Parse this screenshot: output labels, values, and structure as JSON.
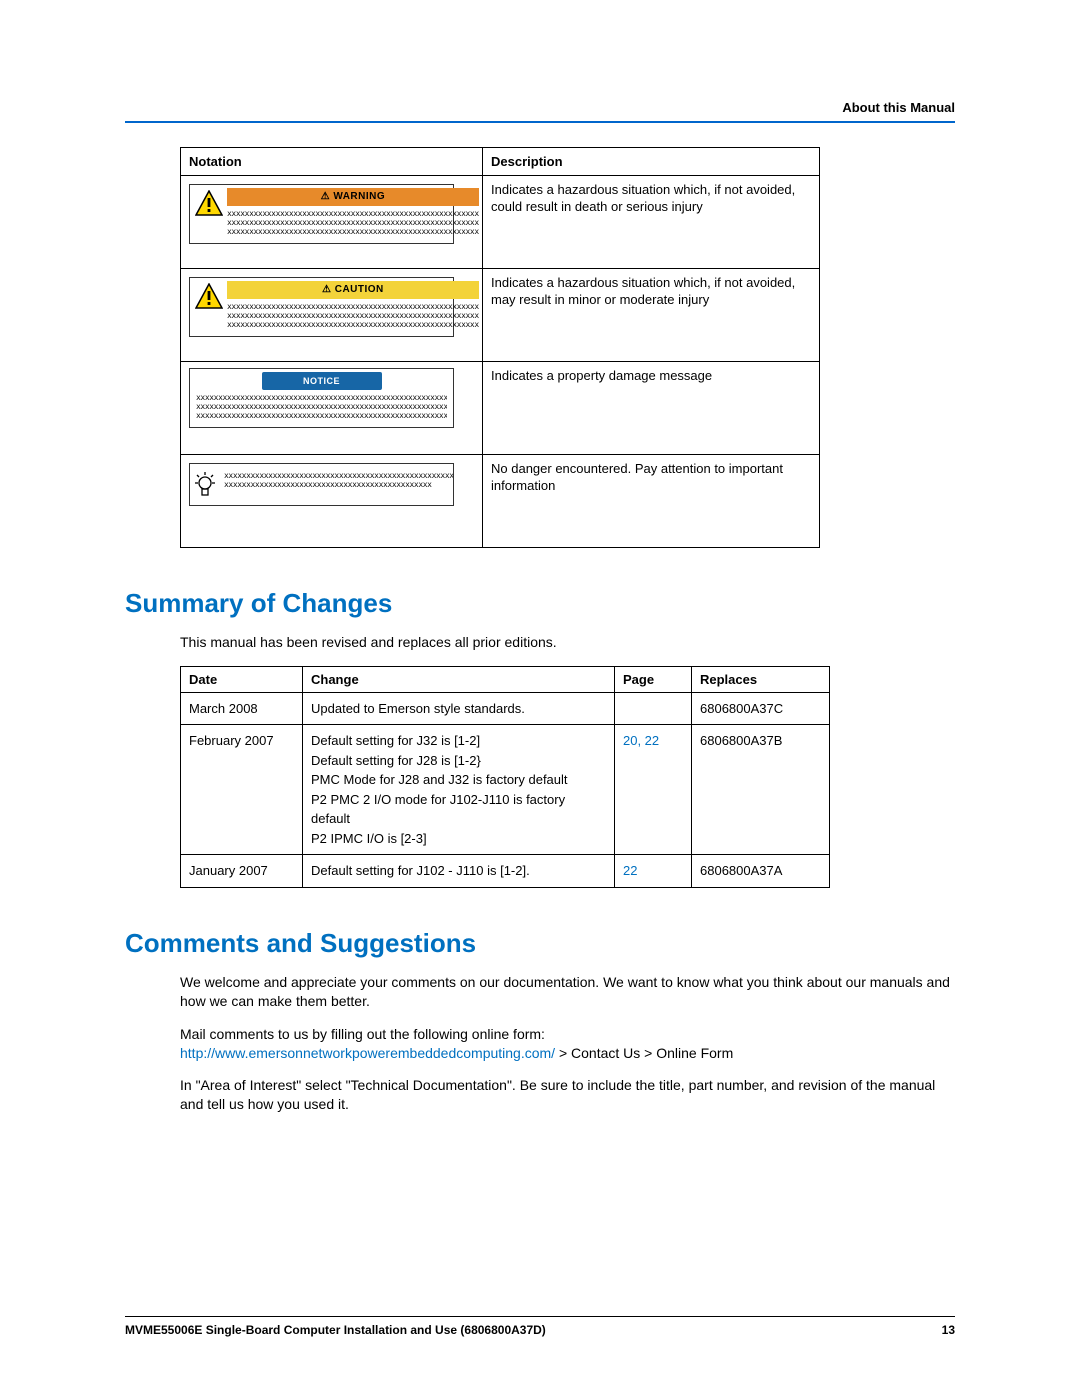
{
  "header": {
    "section": "About this Manual"
  },
  "notation_table": {
    "headers": {
      "notation": "Notation",
      "description": "Description"
    },
    "rows": [
      {
        "label": "WARNING",
        "label_prefix": "⚠",
        "desc": "Indicates a hazardous situation which, if not avoided, could result in death or serious injury"
      },
      {
        "label": "CAUTION",
        "label_prefix": "⚠",
        "desc": "Indicates a hazardous situation which, if not avoided, may result in minor or moderate injury"
      },
      {
        "label": "NOTICE",
        "label_prefix": "",
        "desc": "Indicates a property damage message"
      },
      {
        "label": "",
        "label_prefix": "",
        "desc": "No danger encountered. Pay attention to important information"
      }
    ],
    "placeholder_lines": "xxxxxxxxxxxxxxxxxxxxxxxxxxxxxxxxxxxxxxxxxxxxxxxxxxxxxxxxx\nxxxxxxxxxxxxxxxxxxxxxxxxxxxxxxxxxxxxxxxxxxxxxxxxxxxxxxxxx\nxxxxxxxxxxxxxxxxxxxxxxxxxxxxxxxxxxxxxxxxxxxxxxxxxxxxxxxxx",
    "placeholder_full": "xxxxxxxxxxxxxxxxxxxxxxxxxxxxxxxxxxxxxxxxxxxxxxxxxxxxxxxxxxxxxxxxxxx\nxxxxxxxxxxxxxxxxxxxxxxxxxxxxxxxxxxxxxxxxxxxxxxxxxxxxxxxxxxxxxxxxxxx\nxxxxxxxxxxxxxxxxxxxxxxxxxxxxxxxxxxxxxxxxxxxxxxxxxxxxxxxxxxxxxxxxxxx",
    "placeholder_two": "xxxxxxxxxxxxxxxxxxxxxxxxxxxxxxxxxxxxxxxxxxxxxxxxxxxxxxxxx\nxxxxxxxxxxxxxxxxxxxxxxxxxxxxxxxxxxxxxxxxxxxxxxx"
  },
  "sections": {
    "summary_title": "Summary of Changes",
    "summary_intro": "This manual has been revised and replaces all prior editions.",
    "comments_title": "Comments and Suggestions",
    "comments_p1": "We welcome and appreciate your comments on our documentation. We want to know what you think about our manuals and how we can make them better.",
    "comments_p2a": "Mail comments to us by filling out the following online form:",
    "comments_link": "http://www.emersonnetworkpowerembeddedcomputing.com/",
    "comments_p2b": "  > Contact Us > Online Form",
    "comments_p3": "In \"Area of Interest\" select  \"Technical Documentation\". Be sure to include the title, part number, and revision of the manual and tell us how you used it."
  },
  "changes_table": {
    "headers": {
      "date": "Date",
      "change": "Change",
      "page": "Page",
      "replaces": "Replaces"
    },
    "rows": [
      {
        "date": "March 2008",
        "change": "Updated to Emerson style standards.",
        "page": "",
        "replaces": "6806800A37C"
      },
      {
        "date": "February 2007",
        "change": "Default setting for J32 is [1-2]\nDefault setting for J28 is [1-2}\nPMC Mode for J28 and J32 is factory default\nP2 PMC 2 I/O mode for J102-J110 is factory default\nP2 IPMC I/O is [2-3]",
        "page": "20, 22",
        "replaces": "6806800A37B"
      },
      {
        "date": "January 2007",
        "change": "Default setting for J102 - J110 is [1-2].",
        "page": "22",
        "replaces": "6806800A37A"
      }
    ]
  },
  "footer": {
    "title": "MVME55006E Single-Board Computer Installation and Use (6806800A37D)",
    "page": "13"
  }
}
